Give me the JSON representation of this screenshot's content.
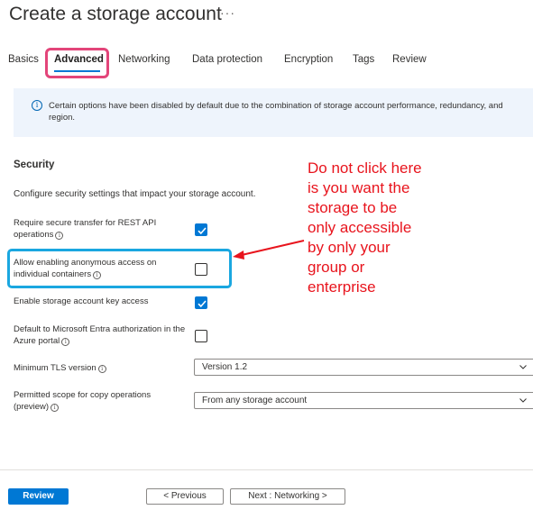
{
  "page": {
    "title": "Create a storage account",
    "more": "···"
  },
  "tabs": [
    {
      "label": "Basics"
    },
    {
      "label": "Advanced"
    },
    {
      "label": "Networking"
    },
    {
      "label": "Data protection"
    },
    {
      "label": "Encryption"
    },
    {
      "label": "Tags"
    },
    {
      "label": "Review"
    }
  ],
  "active_tab": "Advanced",
  "info": {
    "icon": "info-icon",
    "text": "Certain options have been disabled by default due to the combination of storage account performance, redundancy, and region."
  },
  "security": {
    "title": "Security",
    "description": "Configure security settings that impact your storage account.",
    "rows": [
      {
        "label": "Require secure transfer for REST API operations",
        "checked": true
      },
      {
        "label": "Allow enabling anonymous access on individual containers",
        "checked": false
      },
      {
        "label": "Enable storage account key access",
        "checked": true
      },
      {
        "label": "Default to Microsoft Entra authorization in the Azure portal",
        "checked": false
      }
    ],
    "tls_label": "Minimum TLS version",
    "tls_value": "Version 1.2",
    "scope_label": "Permitted scope for copy operations (preview)",
    "scope_value": "From any storage account"
  },
  "annotation": {
    "text": "Do not click here is you want the storage to be only accessible by only your group or enterprise",
    "color": "#e8141d"
  },
  "footer": {
    "review": "Review",
    "previous": "< Previous",
    "next": "Next : Networking >"
  },
  "colors": {
    "accent": "#0078d4",
    "tab_highlight": "#e3457a",
    "box_highlight": "#1aa7e0"
  }
}
